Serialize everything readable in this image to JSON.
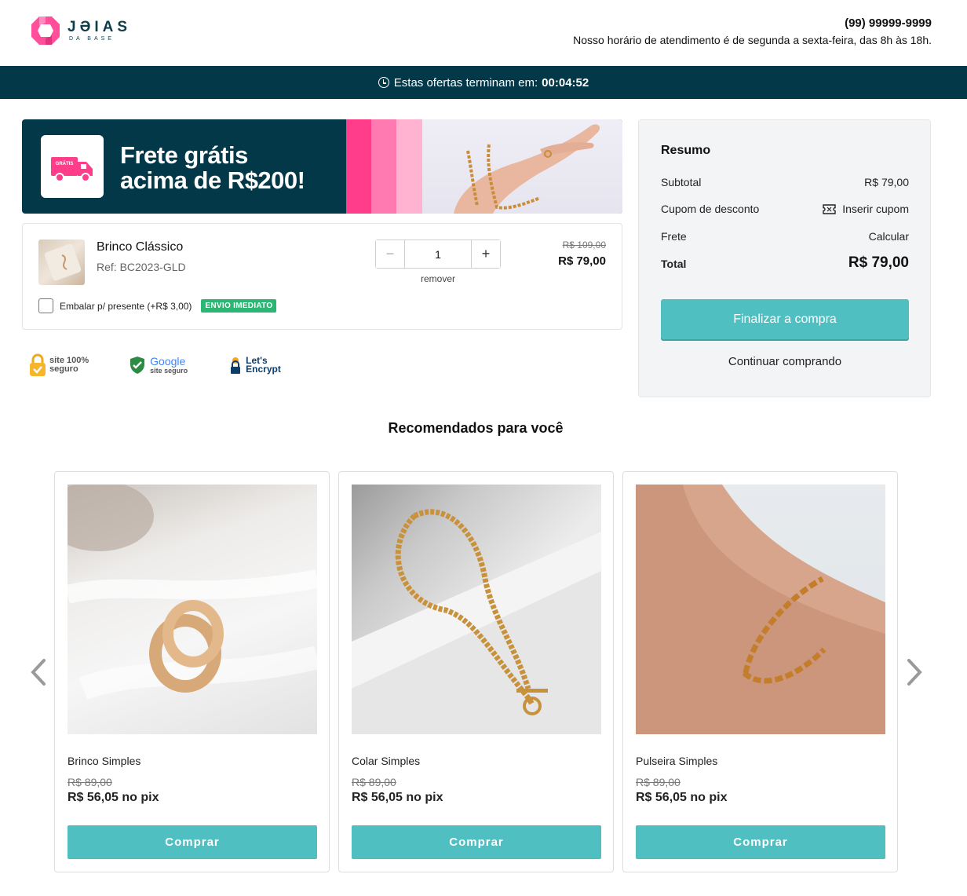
{
  "header": {
    "logo_name": "JƏIAS",
    "logo_sub": "DA BASE",
    "phone": "(99) 99999-9999",
    "hours": "Nosso horário de atendimento é de segunda a sexta-feira, das 8h às 18h."
  },
  "offer_bar": {
    "text": "Estas ofertas terminam em:",
    "timer": "00:04:52",
    "icon": "clock-icon"
  },
  "banner": {
    "badge": "GRÁTIS",
    "line1": "Frete grátis",
    "line2": "acima de R$200!",
    "icon": "truck-icon",
    "colors": {
      "bg": "#023848",
      "pink1": "#ff3d8b",
      "pink2": "#ff7ab0",
      "pink3": "#ffb3d1"
    }
  },
  "cart": {
    "item": {
      "name": "Brinco Clássico",
      "ref": "Ref: BC2023-GLD",
      "quantity": "1",
      "minus": "−",
      "plus": "+",
      "remove": "remover",
      "old_price": "R$ 109,00",
      "price": "R$ 79,00"
    },
    "gift_label": "Embalar p/ presente (+R$ 3,00)",
    "gift_checked": false,
    "shipping_badge": "ENVIO IMEDIATO"
  },
  "seals": {
    "site_line1": "site 100%",
    "site_line2": "seguro",
    "google_line1": "Google",
    "google_line2": "site seguro",
    "le_line1": "Let's",
    "le_line2": "Encrypt"
  },
  "summary": {
    "title": "Resumo",
    "subtotal_label": "Subtotal",
    "subtotal_value": "R$ 79,00",
    "coupon_label": "Cupom de desconto",
    "coupon_action": "Inserir cupom",
    "shipping_label": "Frete",
    "shipping_action": "Calcular",
    "total_label": "Total",
    "total_value": "R$ 79,00",
    "finish_button": "Finalizar a compra",
    "continue_link": "Continuar comprando"
  },
  "recommendations": {
    "title": "Recomendados para você",
    "products": [
      {
        "name": "Brinco Simples",
        "old_price": "R$ 89,00",
        "price": "R$ 56,05 no pix",
        "button": "Comprar"
      },
      {
        "name": "Colar Simples",
        "old_price": "R$ 89,00",
        "price": "R$ 56,05 no pix",
        "button": "Comprar"
      },
      {
        "name": "Pulseira Simples",
        "old_price": "R$ 89,00",
        "price": "R$ 56,05 no pix",
        "button": "Comprar"
      }
    ]
  },
  "colors": {
    "accent": "#4fbfc1",
    "dark": "#023848",
    "success": "#2bb673"
  }
}
